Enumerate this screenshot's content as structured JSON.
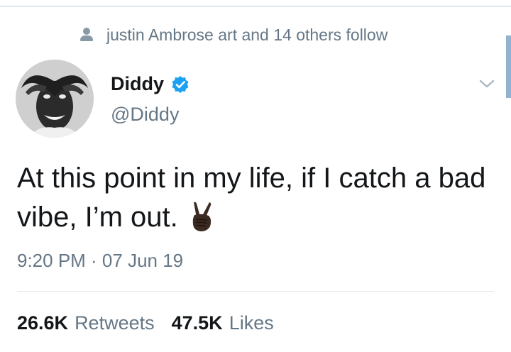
{
  "social_context": {
    "icon": "person-icon",
    "text": "justin Ambrose art and 14 others follow"
  },
  "author": {
    "name": "Diddy",
    "handle": "@Diddy",
    "verified": true,
    "badge_color": "#1da1f2"
  },
  "tweet": {
    "text": "At this point in my life, if I catch a bad vibe, I’m out.",
    "emoji": "victory-hand-dark-skin-tone",
    "timestamp": "9:20 PM · 07 Jun 19"
  },
  "stats": {
    "retweets_count": "26.6K",
    "retweets_label": "Retweets",
    "likes_count": "47.5K",
    "likes_label": "Likes"
  },
  "colors": {
    "text_primary": "#14171a",
    "text_secondary": "#657786",
    "divider": "#e1e8ed",
    "scroll_thumb": "#8fb3d1"
  }
}
